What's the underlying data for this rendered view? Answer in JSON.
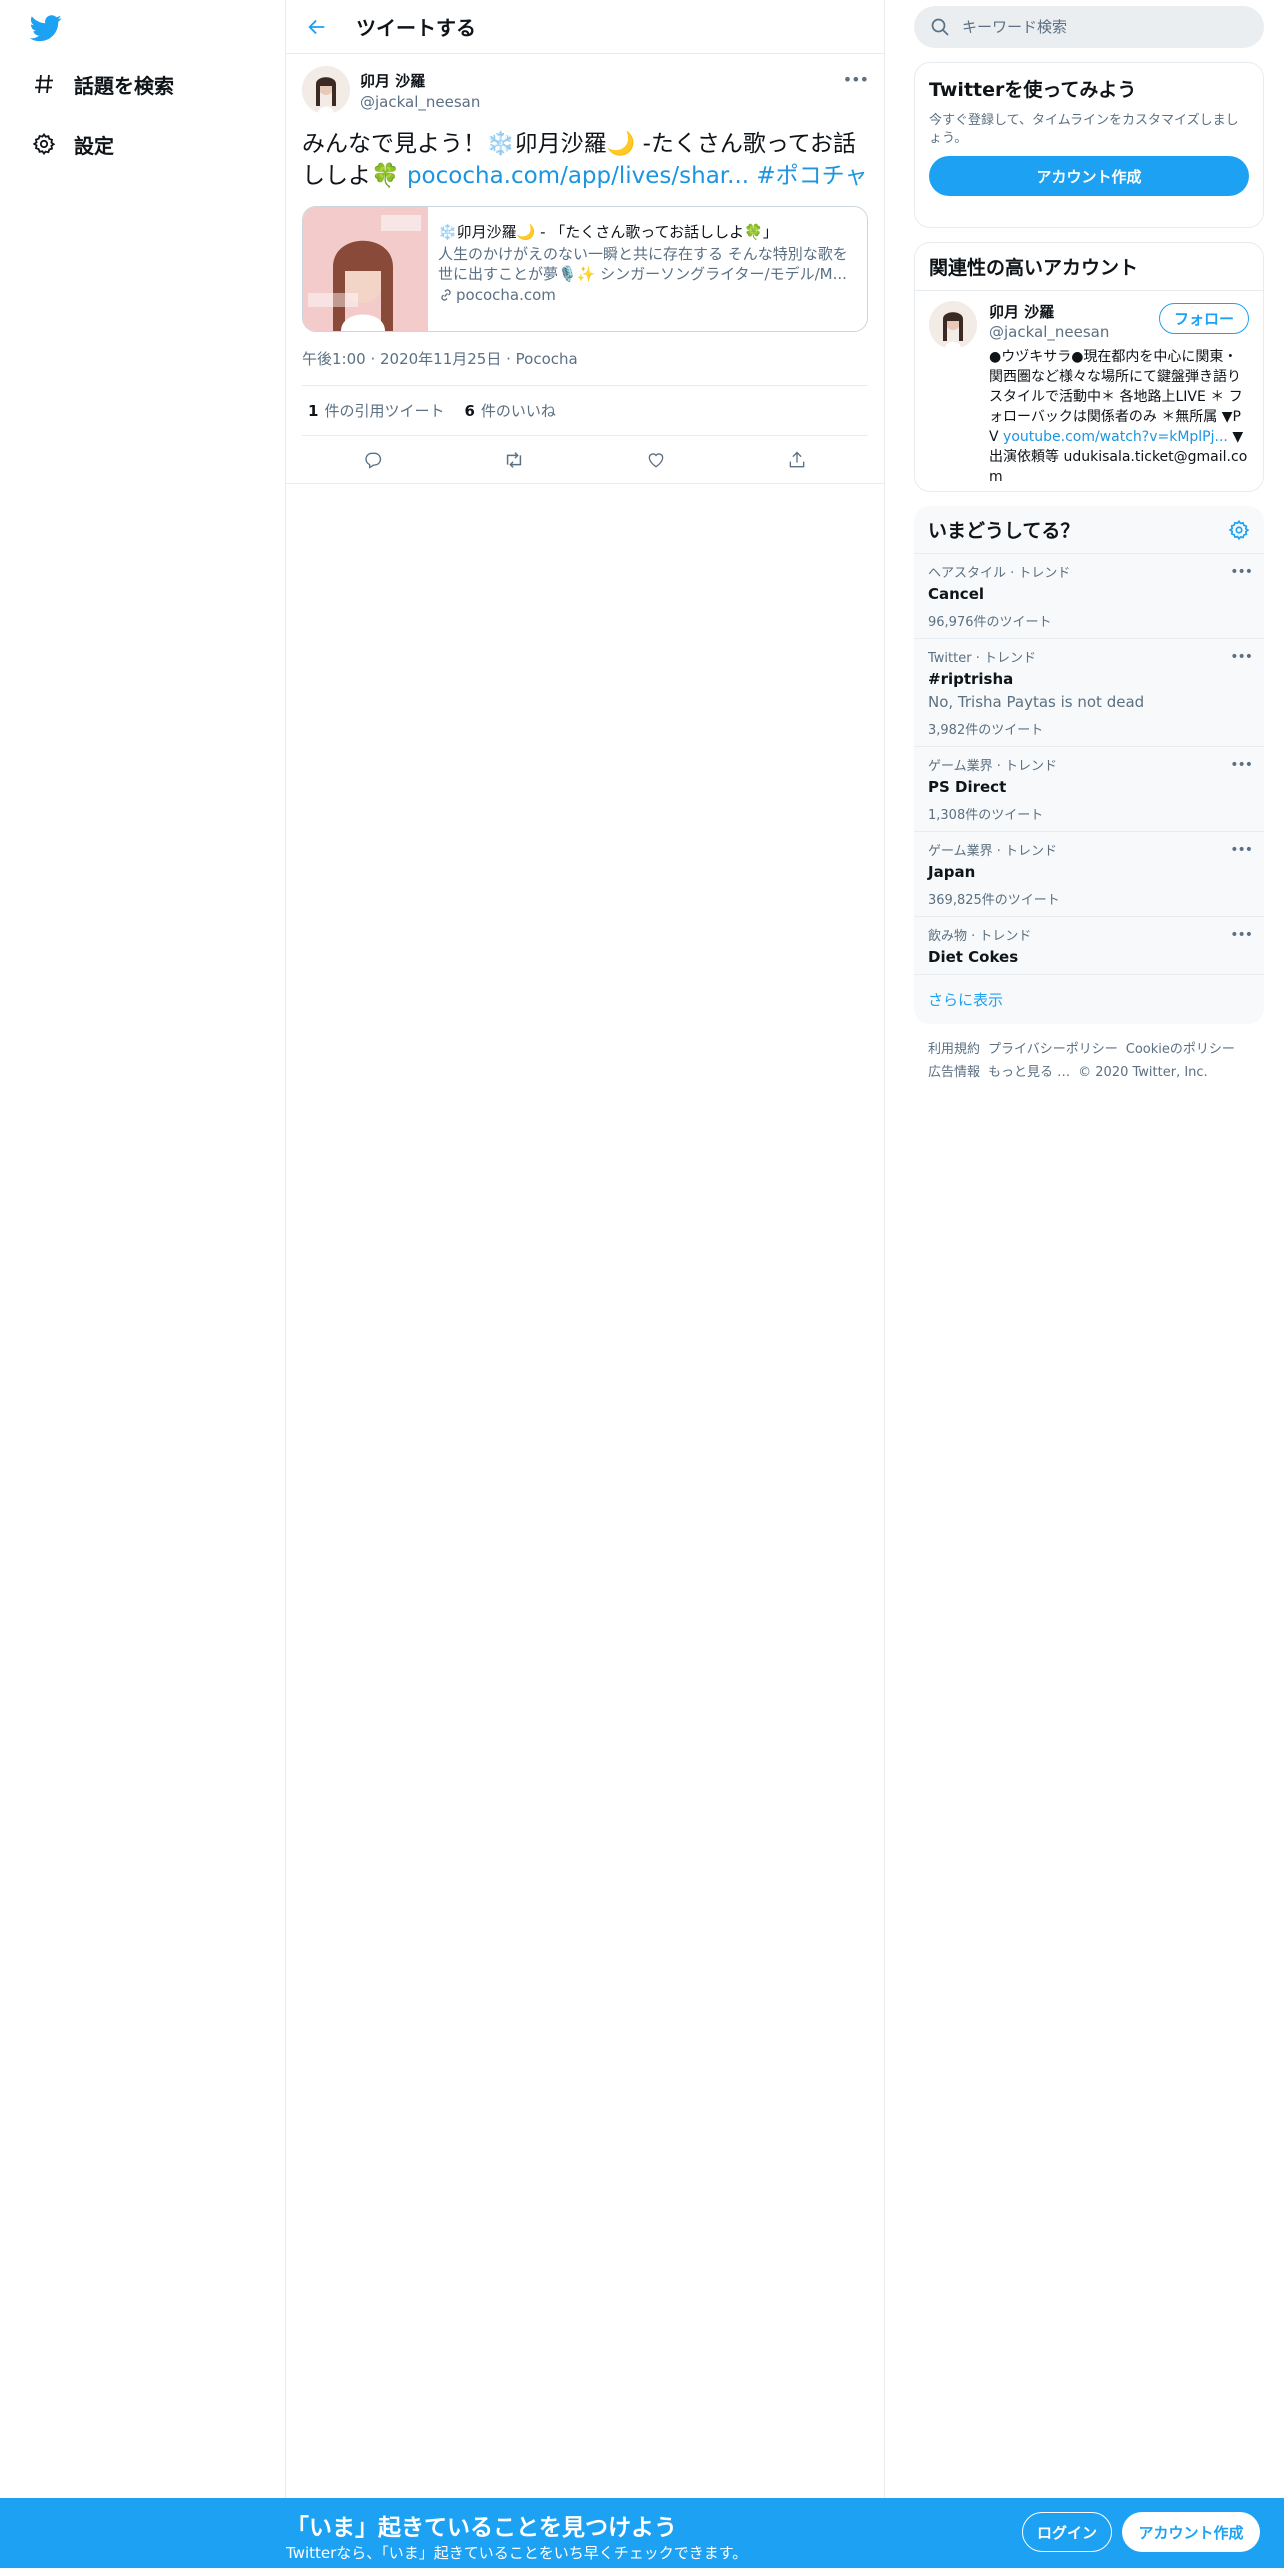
{
  "nav": {
    "logo_icon": "twitter-bird-icon",
    "items": [
      {
        "label": "話題を検索",
        "icon": "hashtag-icon"
      },
      {
        "label": "設定",
        "icon": "gear-icon"
      }
    ]
  },
  "header": {
    "title": "ツイートする",
    "back_icon": "arrow-left-icon"
  },
  "tweet": {
    "author_name": "卯月 沙羅",
    "author_handle": "@jackal_neesan",
    "text_prefix": "みんなで見よう！❄️卯月沙羅🌙 -たくさん歌ってお話ししよ🍀 ",
    "link": "pococha.com/app/lives/shar...",
    "hashtag": "#ポコチャ",
    "card": {
      "title": "❄️卯月沙羅🌙 - 「たくさん歌ってお話ししよ🍀」",
      "description": "人生のかけがえのない一瞬と共に存在する そんな特別な歌を世に出すことが夢🎙️✨ シンガーソングライター/モデル/M...",
      "domain": "pococha.com"
    },
    "time": "午後1:00",
    "date": "2020年11月25日",
    "source": "Pococha",
    "stats": {
      "quote_count": "1",
      "quote_label": "件の引用ツイート",
      "like_count": "6",
      "like_label": "件のいいね"
    }
  },
  "search": {
    "placeholder": "キーワード検索"
  },
  "signup_panel": {
    "title": "Twitterを使ってみよう",
    "description": "今すぐ登録して、タイムラインをカスタマイズしましょう。",
    "button": "アカウント作成"
  },
  "related": {
    "title": "関連性の高いアカウント",
    "user": {
      "name": "卯月 沙羅",
      "handle": "@jackal_neesan",
      "follow_label": "フォロー",
      "bio_text": "●ウヅキサラ●現在都内を中心に関東・関西圏など様々な場所にて鍵盤弾き語りスタイルで活動中＊ 各地路上LIVE ＊ フォローバックは関係者のみ ＊無所属 ▼PV ",
      "bio_link": "youtube.com/watch?v=kMplPj...",
      "bio_tail": " ▼出演依頼等 udukisala.ticket@gmail.com"
    }
  },
  "trends": {
    "title": "いまどうしてる？",
    "items": [
      {
        "category": "ヘアスタイル · トレンド",
        "name": "Cancel",
        "desc": "",
        "count": "96,976件のツイート"
      },
      {
        "category": "Twitter · トレンド",
        "name": "#riptrisha",
        "desc": "No, Trisha Paytas is not dead",
        "count": "3,982件のツイート"
      },
      {
        "category": "ゲーム業界 · トレンド",
        "name": "PS Direct",
        "desc": "",
        "count": "1,308件のツイート"
      },
      {
        "category": "ゲーム業界 · トレンド",
        "name": "Japan",
        "desc": "",
        "count": "369,825件のツイート"
      },
      {
        "category": "飲み物 · トレンド",
        "name": "Diet Cokes",
        "desc": "",
        "count": ""
      }
    ],
    "show_more": "さらに表示"
  },
  "footer": {
    "links": [
      "利用規約",
      "プライバシーポリシー",
      "Cookieのポリシー",
      "広告情報",
      "もっと見る …"
    ],
    "copyright": "© 2020 Twitter, Inc."
  },
  "bottom_bar": {
    "title": "「いま」起きていることを見つけよう",
    "subtitle": "Twitterなら、「いま」起きていることをいち早くチェックできます。",
    "login": "ログイン",
    "signup": "アカウント作成"
  },
  "colors": {
    "accent": "#1da1f2",
    "link": "#1b95e0",
    "muted": "#5b7083"
  }
}
